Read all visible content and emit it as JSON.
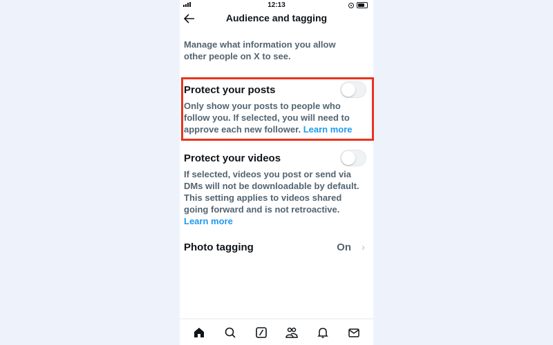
{
  "status_bar": {
    "time": "12:13"
  },
  "header": {
    "title": "Audience and tagging",
    "back_icon": "arrow-left-icon"
  },
  "intro": "Manage what information you allow other people on X to see.",
  "settings": [
    {
      "title": "Protect your posts",
      "description": "Only show your posts to people who follow you. If selected, you will need to approve each new follower.",
      "link": "Learn more",
      "toggle_on": false
    },
    {
      "title": "Protect your videos",
      "description": "If selected, videos you post or send via DMs will not be downloadable by default. This setting applies to videos shared going forward and is not retroactive.",
      "link": "Learn more",
      "toggle_on": false
    }
  ],
  "photo_tagging": {
    "label": "Photo tagging",
    "value": "On"
  },
  "tab_bar": [
    "home-icon",
    "search-icon",
    "grok-icon",
    "communities-icon",
    "notifications-icon",
    "messages-icon"
  ],
  "colors": {
    "accent": "#1d9bf0",
    "highlight": "#e8341c",
    "text": "#0f1419",
    "secondary": "#536471"
  }
}
